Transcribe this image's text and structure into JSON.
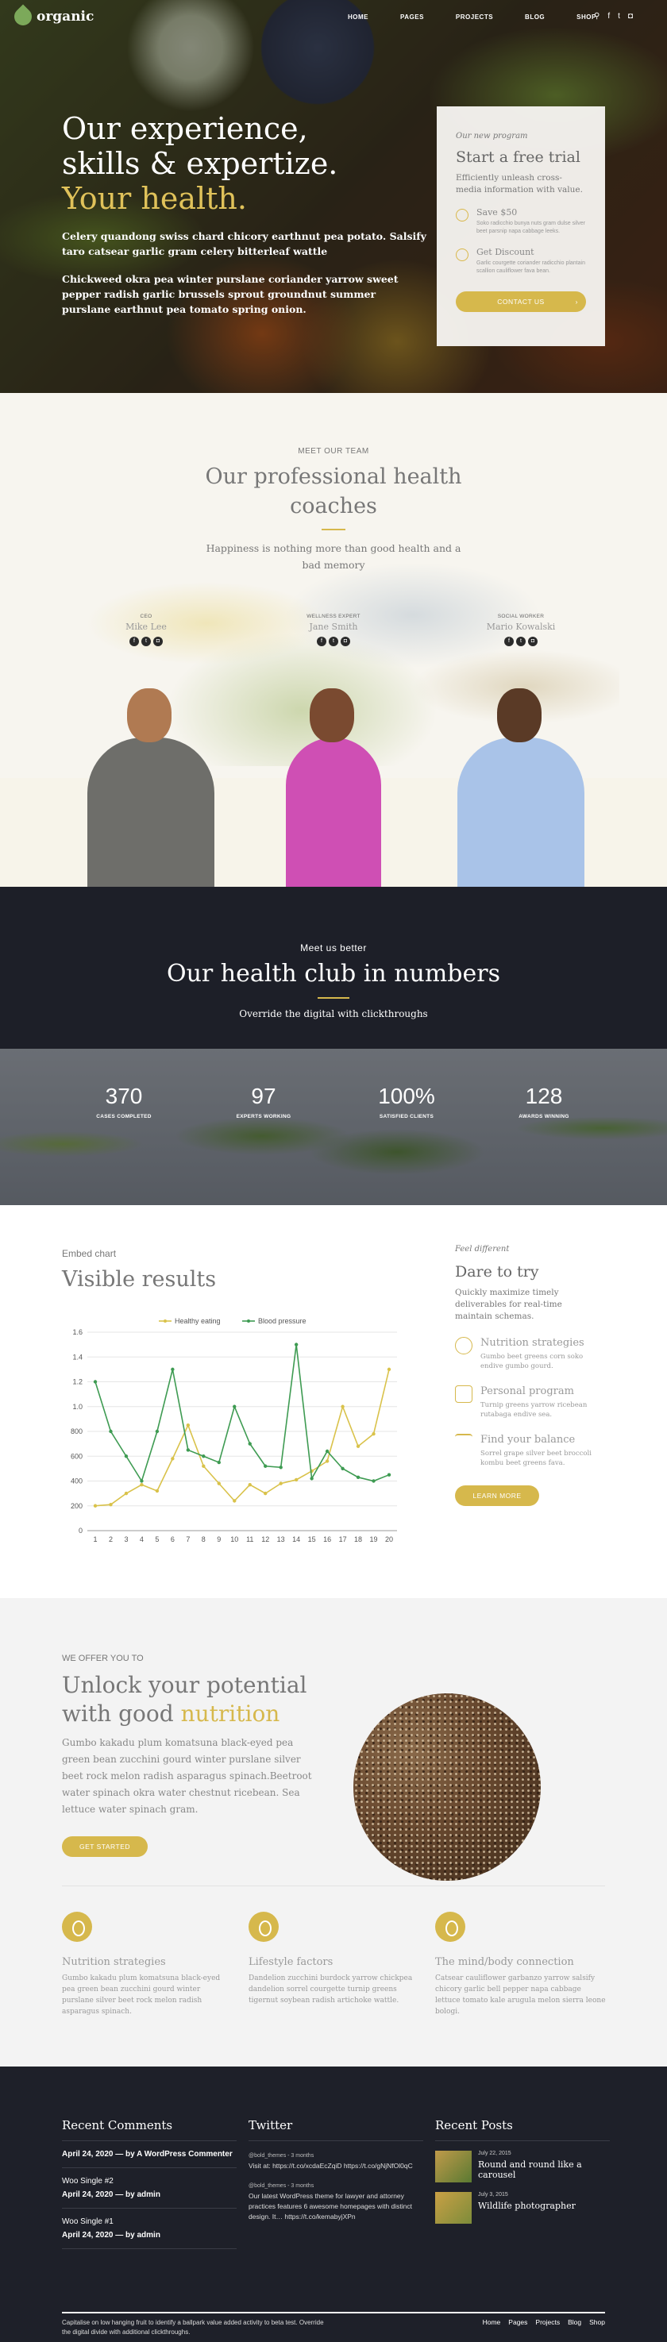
{
  "nav": {
    "logo": "organic",
    "menu": [
      "HOME",
      "PAGES",
      "PROJECTS",
      "BLOG",
      "SHOP"
    ],
    "icons": [
      "search-icon",
      "facebook-icon",
      "twitter-icon",
      "instagram-icon"
    ]
  },
  "hero": {
    "line1": "Our experience,",
    "line2": "skills & expertize.",
    "line3": "Your health.",
    "p1": "Celery quandong swiss chard chicory earthnut pea potato. Salsify taro catsear garlic gram celery bitterleaf wattle",
    "p2": "Chickweed okra pea winter purslane coriander yarrow sweet pepper radish garlic brussels sprout groundnut summer purslane earthnut pea tomato spring onion."
  },
  "trial": {
    "tag": "Our new program",
    "title": "Start a free trial",
    "sub": "Efficiently unleash cross-media information with value.",
    "f1_title": "Save $50",
    "f1_text": "Soko radicchio bunya nuts gram dulse silver beet parsnip napa cabbage leeks.",
    "f2_title": "Get Discount",
    "f2_text": "Garlic courgette coriander radicchio plantain scallion cauliflower fava bean.",
    "button": "CONTACT US"
  },
  "team": {
    "eyebrow": "MEET OUR TEAM",
    "title": "Our professional health coaches",
    "sub": "Happiness is nothing more than good health and a bad memory",
    "members": [
      {
        "role": "CEO",
        "name": "Mike Lee"
      },
      {
        "role": "WELLNESS EXPERT",
        "name": "Jane Smith"
      },
      {
        "role": "SOCIAL WORKER",
        "name": "Mario Kowalski"
      }
    ]
  },
  "numbers": {
    "eyebrow": "Meet us better",
    "title": "Our health club in numbers",
    "sub": "Override the digital with clickthroughs",
    "stats": [
      {
        "n": "370",
        "l": "CASES COMPLETED"
      },
      {
        "n": "97",
        "l": "EXPERTS WORKING"
      },
      {
        "n": "100%",
        "l": "SATISFIED CLIENTS"
      },
      {
        "n": "128",
        "l": "AWARDS WINNING"
      }
    ]
  },
  "chart_section": {
    "eyebrow": "Embed chart",
    "title": "Visible results"
  },
  "chart_data": {
    "type": "line",
    "x": [
      1,
      2,
      3,
      4,
      5,
      6,
      7,
      8,
      9,
      10,
      11,
      12,
      13,
      14,
      15,
      16,
      17,
      18,
      19,
      20
    ],
    "ytick_labels": [
      "0",
      "200",
      "400",
      "600",
      "800",
      "1.0",
      "1.2",
      "1.4",
      "1.6"
    ],
    "ylim": [
      0,
      1600
    ],
    "grid": true,
    "legend": "top",
    "series": [
      {
        "name": "Healthy eating",
        "color": "#d9c24a",
        "values": [
          200,
          210,
          300,
          370,
          320,
          580,
          850,
          520,
          380,
          240,
          370,
          300,
          380,
          410,
          480,
          560,
          1000,
          680,
          780,
          1300
        ]
      },
      {
        "name": "Blood pressure",
        "color": "#3e9b52",
        "values": [
          1200,
          800,
          600,
          400,
          800,
          1300,
          650,
          600,
          550,
          1000,
          700,
          520,
          510,
          1500,
          420,
          640,
          500,
          430,
          400,
          450
        ]
      }
    ]
  },
  "side": {
    "tag": "Feel different",
    "title": "Dare to try",
    "sub": "Quickly maximize timely deliverables for real-time maintain schemas.",
    "items": [
      {
        "t": "Nutrition strategies",
        "d": "Gumbo beet greens corn soko endive gumbo gourd."
      },
      {
        "t": "Personal program",
        "d": "Turnip greens yarrow ricebean rutabaga endive sea."
      },
      {
        "t": "Find your balance",
        "d": "Sorrel grape silver beet broccoli kombu beet greens fava."
      }
    ],
    "button": "LEARN MORE"
  },
  "nutrition": {
    "eyebrow": "WE OFFER YOU TO",
    "title_a": "Unlock your potential with good ",
    "title_b": "nutrition",
    "p": "Gumbo kakadu plum komatsuna black-eyed pea green bean zucchini gourd winter purslane silver beet rock melon radish asparagus spinach.Beetroot water spinach okra water chestnut ricebean. Sea lettuce water spinach gram.",
    "button": "GET STARTED",
    "cols": [
      {
        "t": "Nutrition strategies",
        "d": "Gumbo kakadu plum komatsuna black-eyed pea green bean zucchini gourd winter purslane silver beet rock melon radish asparagus spinach."
      },
      {
        "t": "Lifestyle factors",
        "d": "Dandelion zucchini burdock yarrow chickpea dandelion sorrel courgette turnip greens tigernut soybean radish artichoke wattle."
      },
      {
        "t": "The mind/body connection",
        "d": "Catsear cauliflower garbanzo yarrow salsify chicory garlic bell pepper napa cabbage lettuce tomato kale arugula melon sierra leone bologi."
      }
    ]
  },
  "footer": {
    "comments_title": "Recent Comments",
    "comments": [
      {
        "a": "April 24, 2020",
        "b": " — by A WordPress Commenter"
      },
      {
        "a": "Woo Single #2",
        "b": ""
      },
      {
        "a": "April 24, 2020",
        "b": " — by admin"
      },
      {
        "a": "Woo Single #1",
        "b": ""
      },
      {
        "a": "April 24, 2020",
        "b": " — by admin"
      }
    ],
    "twitter_title": "Twitter",
    "tweets": [
      {
        "h": "@bold_themes - 3 months",
        "t": "Visit at: https://t.co/xcdaEcZqiD https://t.co/gNjNfOl0qC"
      },
      {
        "h": "@bold_themes - 3 months",
        "t": "Our latest WordPress theme for lawyer and attorney practices features 6 awesome homepages with distinct design. It… https://t.co/kemabyjXPn"
      }
    ],
    "posts_title": "Recent Posts",
    "posts": [
      {
        "d": "July 22, 2015",
        "t": "Round and round like a carousel"
      },
      {
        "d": "July 3, 2015",
        "t": "Wildlife photographer"
      }
    ],
    "copy": "Capitalise on low hanging fruit to identify a ballpark value added activity to beta test. Override the digital divide with additional clickthroughs.",
    "links": [
      "Home",
      "Pages",
      "Projects",
      "Blog",
      "Shop"
    ]
  }
}
